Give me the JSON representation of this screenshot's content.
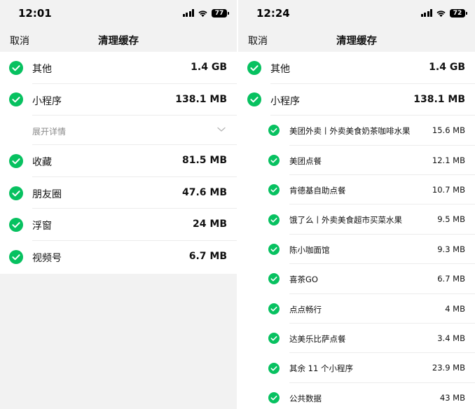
{
  "colors": {
    "accent_green": "#07c160",
    "screen_gray": "#f2f2f2"
  },
  "left": {
    "status": {
      "time": "12:01",
      "battery": "77"
    },
    "nav": {
      "cancel": "取消",
      "title": "清理缓存"
    },
    "rows": [
      {
        "label": "其他",
        "size": "1.4 GB",
        "checked": true
      },
      {
        "label": "小程序",
        "size": "138.1 MB",
        "checked": true
      }
    ],
    "expand": {
      "label": "展开详情",
      "icon": "chevron-down-icon"
    },
    "rows2": [
      {
        "label": "收藏",
        "size": "81.5 MB",
        "checked": true
      },
      {
        "label": "朋友圈",
        "size": "47.6 MB",
        "checked": true
      },
      {
        "label": "浮窗",
        "size": "24 MB",
        "checked": true
      },
      {
        "label": "视频号",
        "size": "6.7 MB",
        "checked": true
      }
    ]
  },
  "right": {
    "status": {
      "time": "12:24",
      "battery": "72"
    },
    "nav": {
      "cancel": "取消",
      "title": "清理缓存"
    },
    "rows": [
      {
        "label": "其他",
        "size": "1.4 GB",
        "checked": true
      },
      {
        "label": "小程序",
        "size": "138.1 MB",
        "checked": true
      }
    ],
    "subitems": [
      {
        "label": "美团外卖丨外卖美食奶茶咖啡水果",
        "size": "15.6 MB"
      },
      {
        "label": "美团点餐",
        "size": "12.1 MB"
      },
      {
        "label": "肯德基自助点餐",
        "size": "10.7 MB"
      },
      {
        "label": "饿了么丨外卖美食超市买菜水果",
        "size": "9.5 MB"
      },
      {
        "label": "陈小咖面馆",
        "size": "9.3 MB"
      },
      {
        "label": "喜茶GO",
        "size": "6.7 MB"
      },
      {
        "label": "点点畅行",
        "size": "4 MB"
      },
      {
        "label": "达美乐比萨点餐",
        "size": "3.4 MB"
      },
      {
        "label": "其余 11 个小程序",
        "size": "23.9 MB"
      },
      {
        "label": "公共数据",
        "size": "43 MB"
      }
    ]
  }
}
